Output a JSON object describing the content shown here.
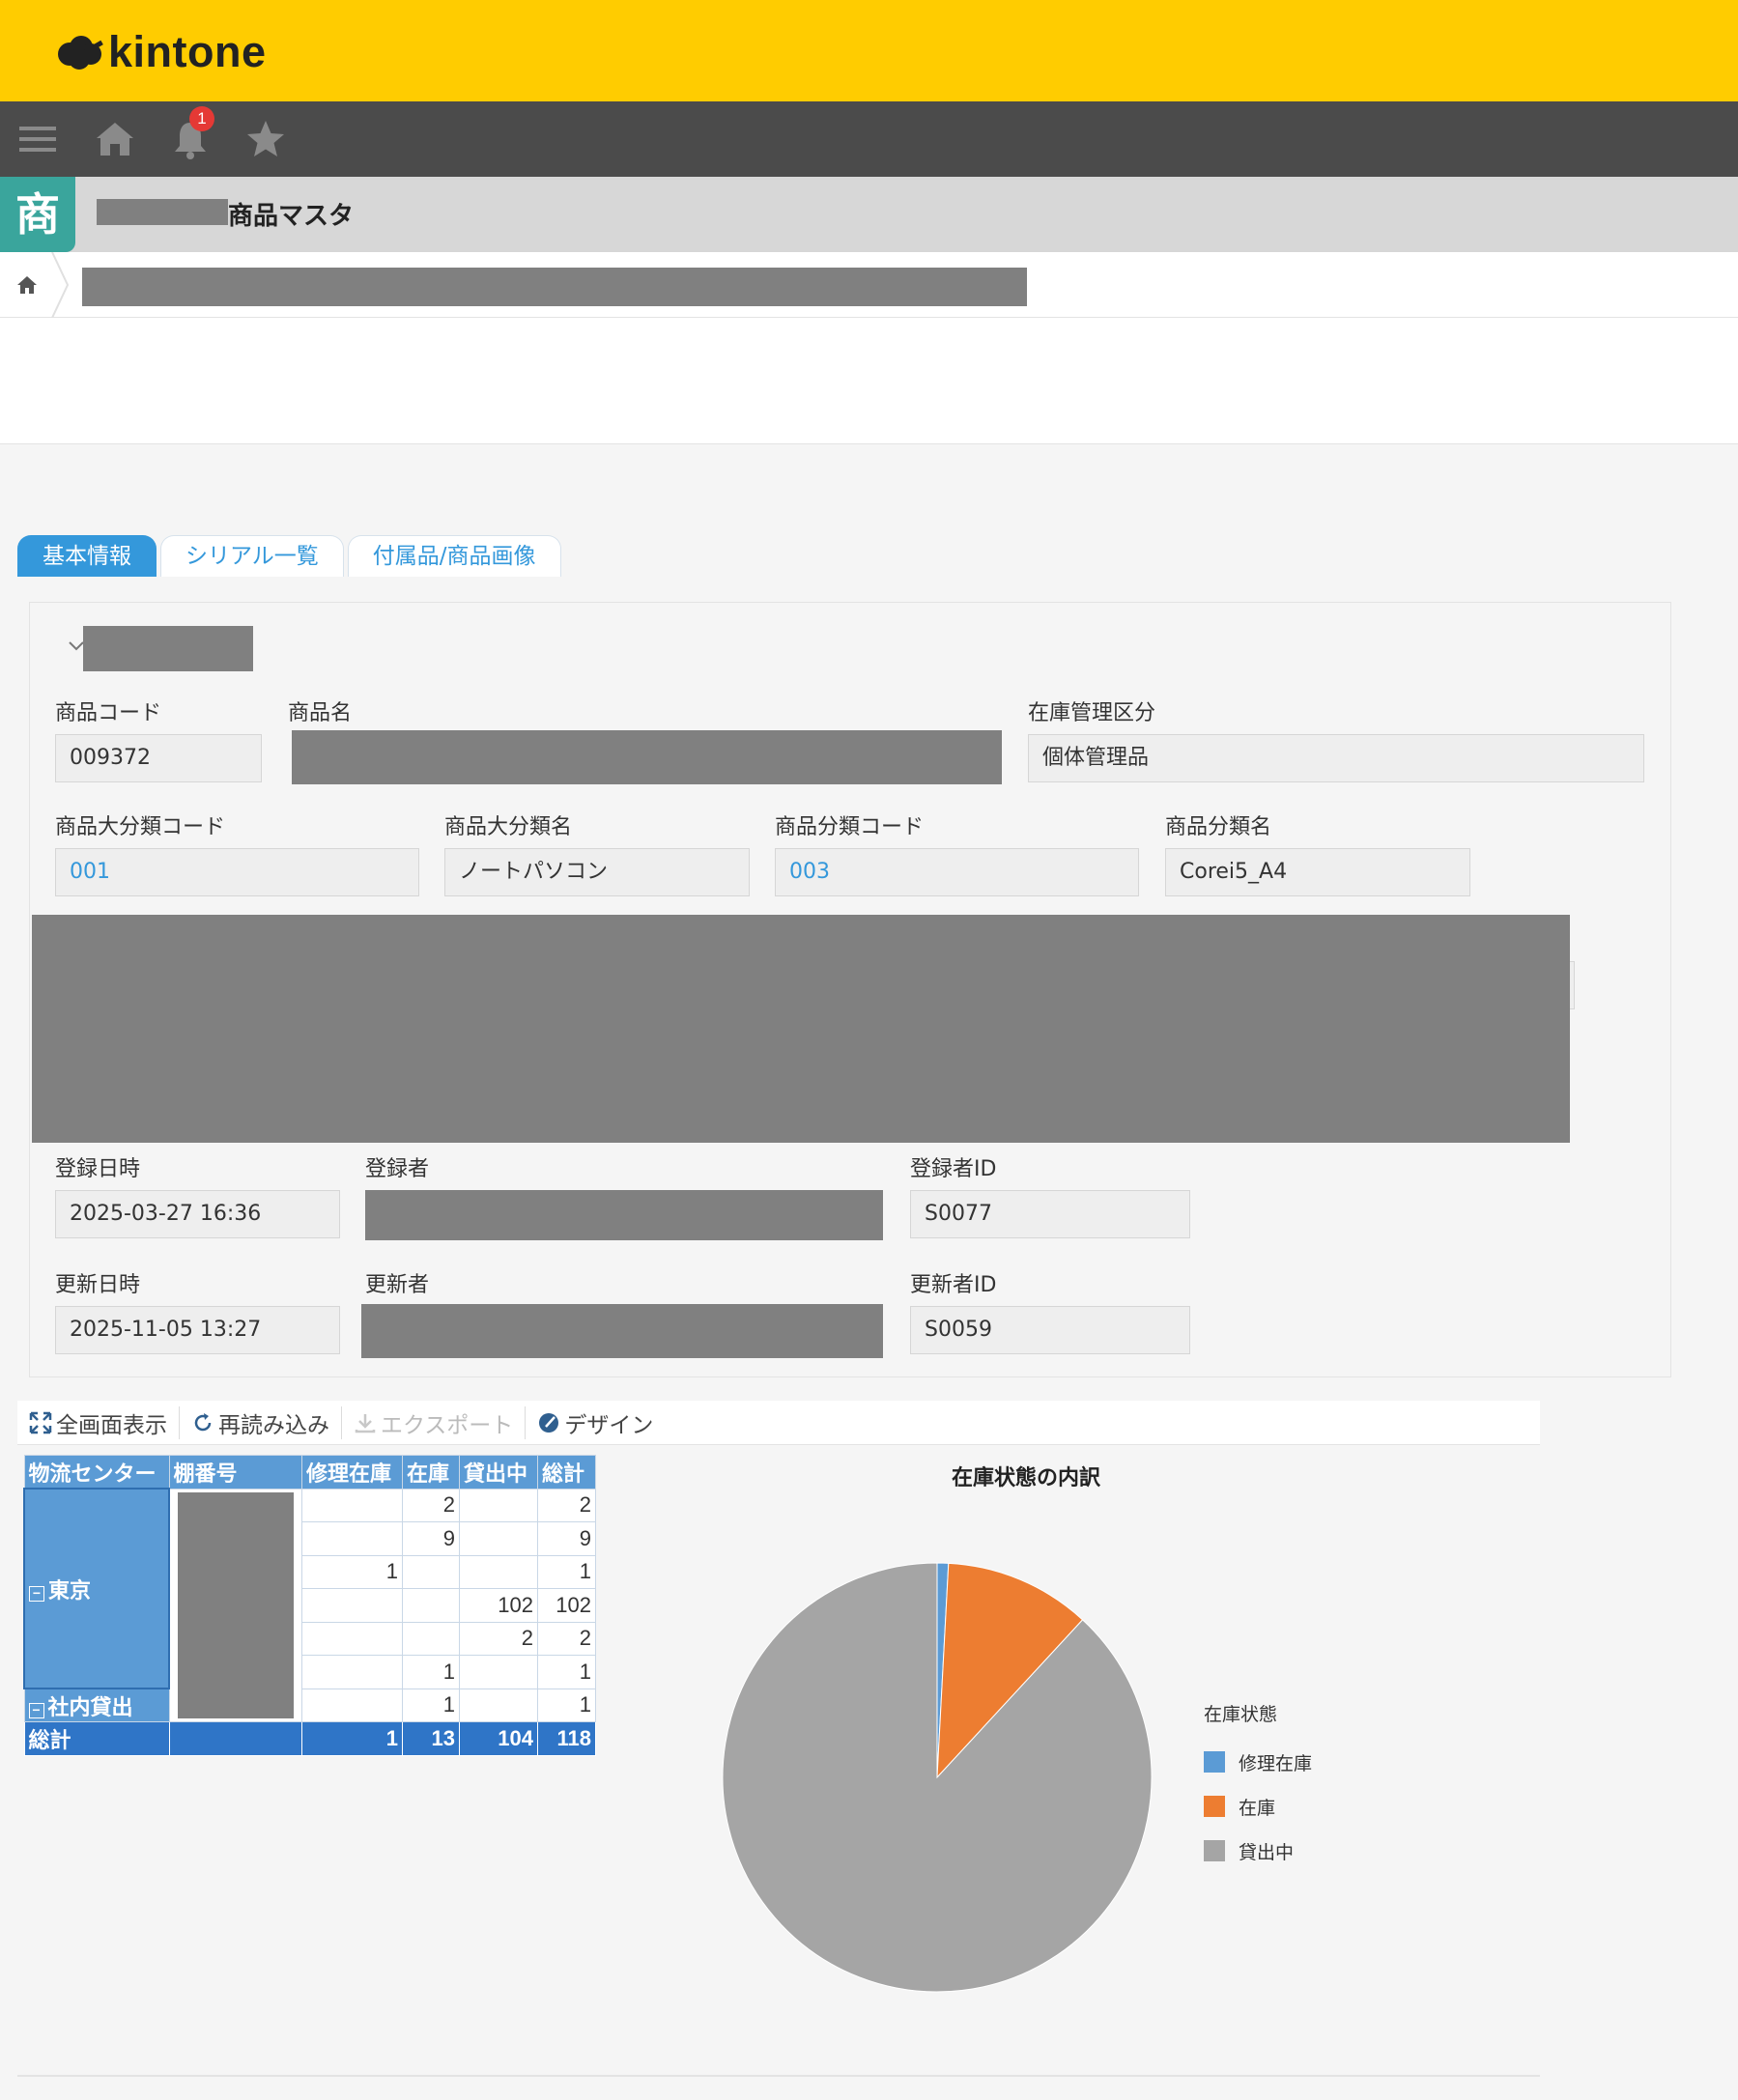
{
  "header": {
    "logo_text": "kintone",
    "logo_icon": "kintone-cloud-icon"
  },
  "navbar": {
    "notification_count": "1",
    "icons": [
      "menu-icon",
      "home-icon",
      "bell-icon",
      "star-icon"
    ]
  },
  "app": {
    "icon_char": "商",
    "title": "商品マスタ"
  },
  "tabs": [
    {
      "label": "基本情報",
      "active": true
    },
    {
      "label": "シリアル一覧",
      "active": false
    },
    {
      "label": "付属品/商品画像",
      "active": false
    }
  ],
  "fields": {
    "product_code": {
      "label": "商品コード",
      "value": "009372"
    },
    "product_name": {
      "label": "商品名"
    },
    "stock_mgmt": {
      "label": "在庫管理区分",
      "value": "個体管理品"
    },
    "major_cat_code": {
      "label": "商品大分類コード",
      "value": "001"
    },
    "major_cat_name": {
      "label": "商品大分類名",
      "value": "ノートパソコン"
    },
    "cat_code": {
      "label": "商品分類コード",
      "value": "003"
    },
    "cat_name": {
      "label": "商品分類名",
      "value": "Corei5_A4"
    },
    "created_at": {
      "label": "登録日時",
      "value": "2025-03-27 16:36"
    },
    "created_by": {
      "label": "登録者"
    },
    "created_by_id": {
      "label": "登録者ID",
      "value": "S0077"
    },
    "updated_at": {
      "label": "更新日時",
      "value": "2025-11-05 13:27"
    },
    "updated_by": {
      "label": "更新者"
    },
    "updated_by_id": {
      "label": "更新者ID",
      "value": "S0059"
    }
  },
  "toolbar": {
    "fullscreen": "全画面表示",
    "reload": "再読み込み",
    "export": "エクスポート",
    "design": "デザイン"
  },
  "pivot": {
    "headers": [
      "物流センター",
      "棚番号",
      "修理在庫",
      "在庫",
      "貸出中",
      "総計"
    ],
    "group1": "東京",
    "group2": "社内貸出",
    "rows": [
      [
        "",
        "2",
        "",
        "2"
      ],
      [
        "",
        "9",
        "",
        "9"
      ],
      [
        "1",
        "",
        "",
        "1"
      ],
      [
        "",
        "",
        "102",
        "102"
      ],
      [
        "",
        "",
        "2",
        "2"
      ],
      [
        "",
        "1",
        "",
        "1"
      ],
      [
        "",
        "1",
        "",
        "1"
      ]
    ],
    "total_label": "総計",
    "totals": [
      "1",
      "13",
      "104",
      "118"
    ]
  },
  "chart_data": {
    "type": "pie",
    "title": "在庫状態の内訳",
    "legend_title": "在庫状態",
    "legend_position": "right",
    "categories": [
      "修理在庫",
      "在庫",
      "貸出中"
    ],
    "values": [
      1,
      13,
      104
    ],
    "colors": [
      "#5b9bd5",
      "#ed7d31",
      "#a5a5a5"
    ]
  }
}
